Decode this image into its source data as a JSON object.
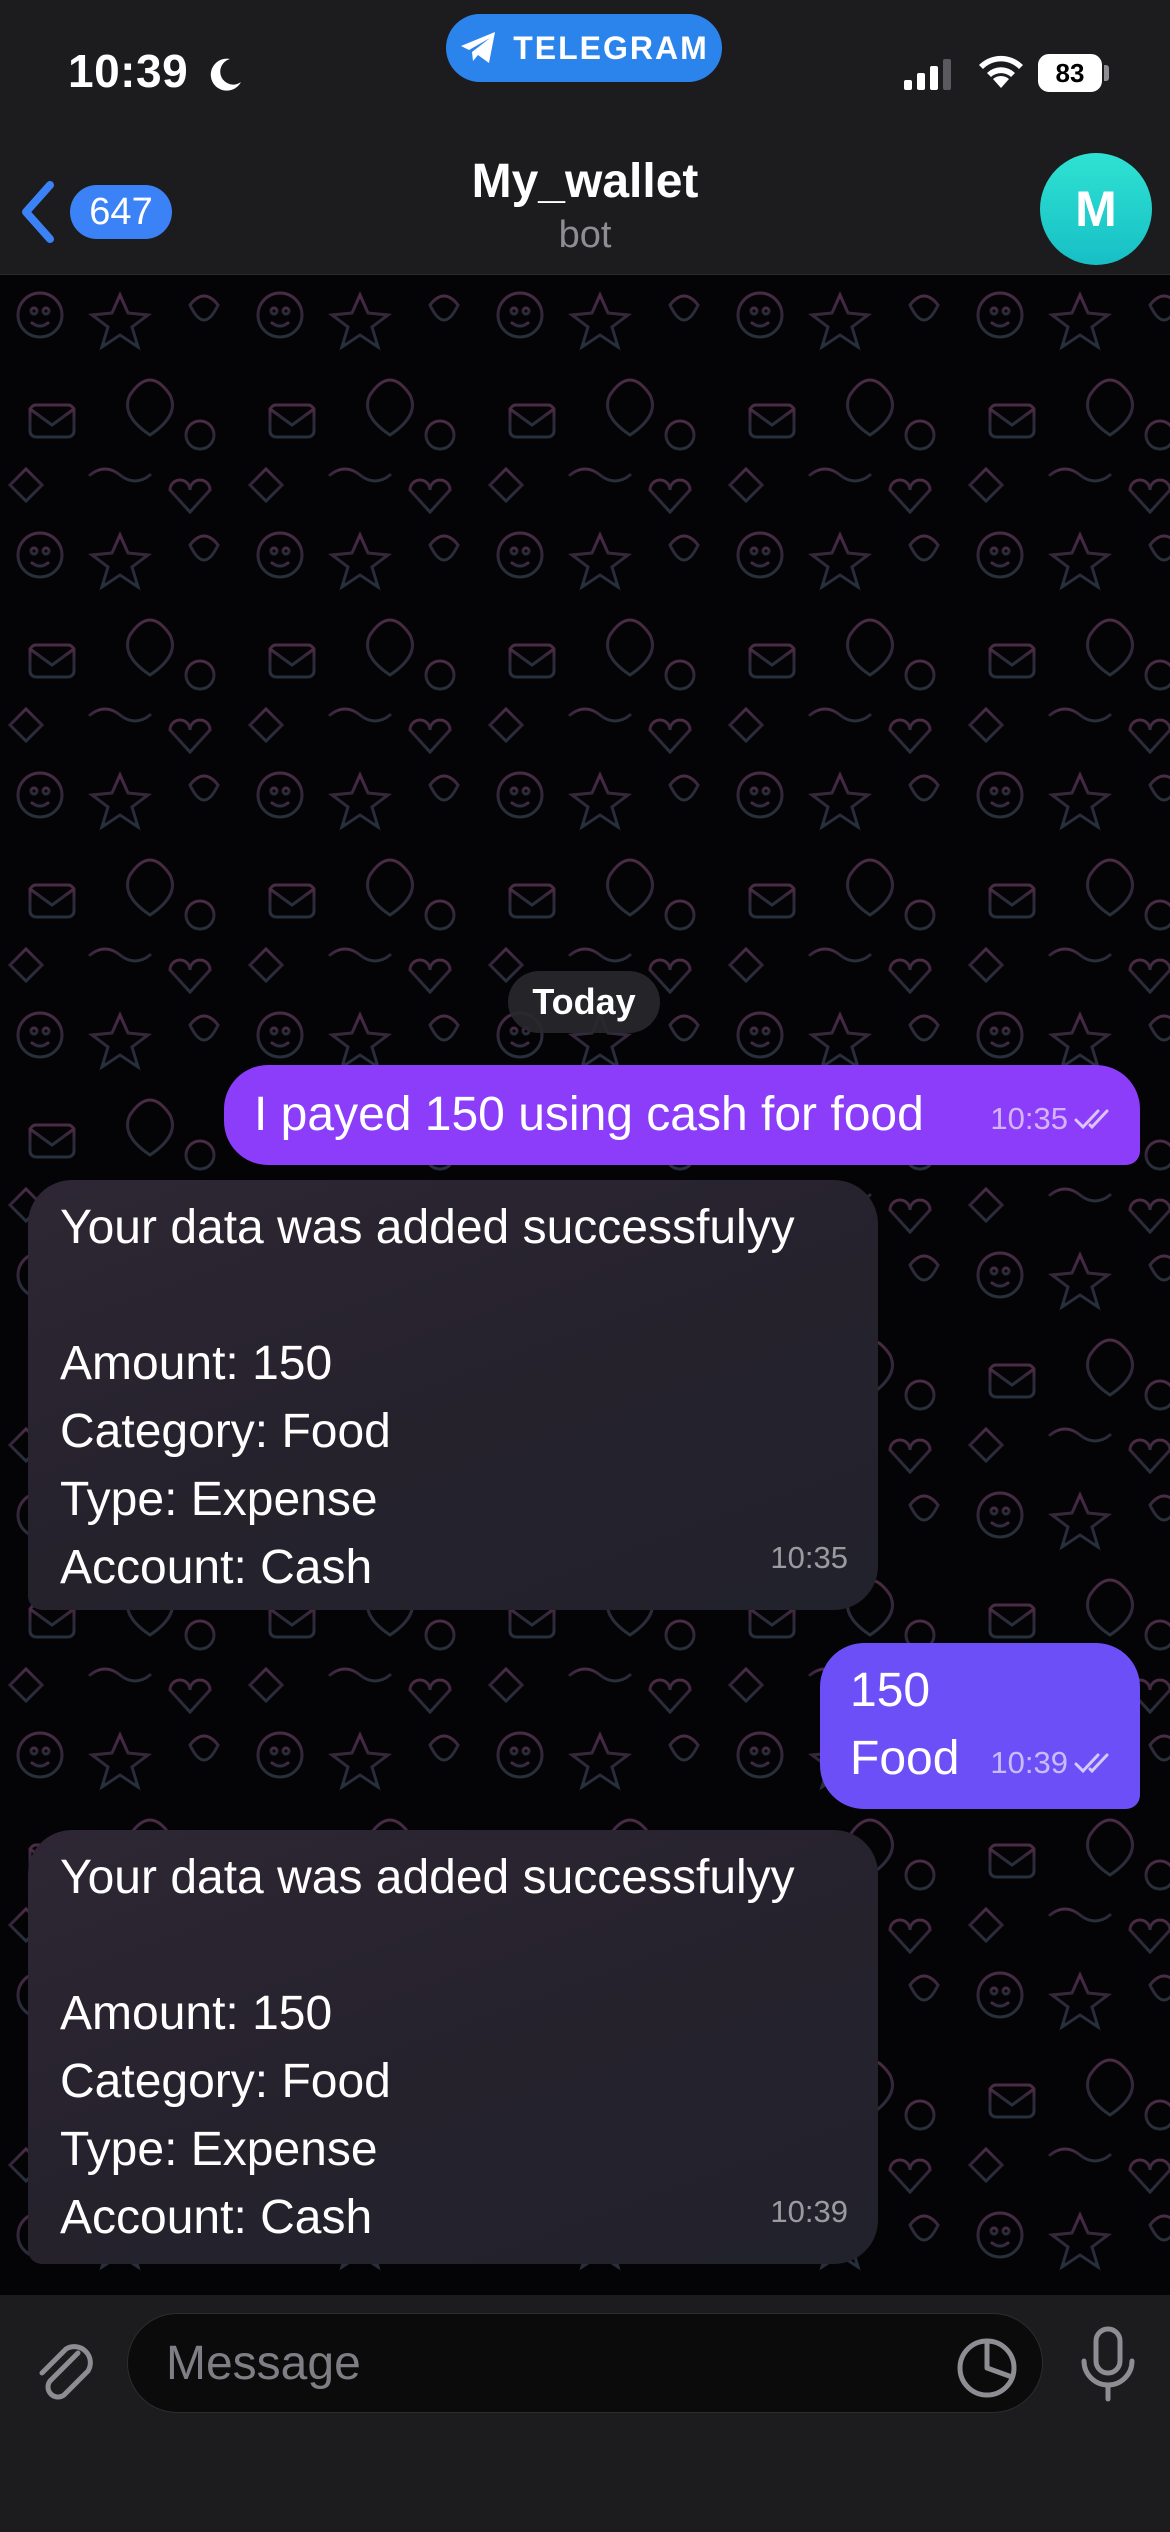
{
  "status_bar": {
    "time": "10:39",
    "pill_label": "TELEGRAM",
    "battery_level": "83"
  },
  "header": {
    "unread_count": "647",
    "title": "My_wallet",
    "subtitle": "bot",
    "avatar_initial": "M",
    "avatar_color": "#22d3c8"
  },
  "chat": {
    "date_label": "Today",
    "messages": [
      {
        "direction": "outgoing",
        "lines": [
          "I payed 150 using cash for food"
        ],
        "time": "10:35",
        "status": "read",
        "color": "#8b3dfa"
      },
      {
        "direction": "incoming",
        "lines": [
          "Your data was added successfulyy",
          "",
          "Amount: 150",
          "Category: Food",
          "Type: Expense",
          "Account: Cash"
        ],
        "time": "10:35"
      },
      {
        "direction": "outgoing",
        "lines": [
          "150",
          "Food"
        ],
        "time": "10:39",
        "status": "read",
        "color": "#6d4ff7"
      },
      {
        "direction": "incoming",
        "lines": [
          "Your data was added successfulyy",
          "",
          "Amount: 150",
          "Category: Food",
          "Type: Expense",
          "Account: Cash"
        ],
        "time": "10:39"
      }
    ]
  },
  "input_bar": {
    "placeholder": "Message"
  },
  "icons": {
    "back": "chevron-left-icon",
    "attach": "paperclip-icon",
    "sticker": "sticker-icon",
    "mic": "microphone-icon",
    "read_status": "double-check-icon"
  },
  "colors": {
    "accent": "#3b82f6",
    "pill": "#2b84ec"
  }
}
